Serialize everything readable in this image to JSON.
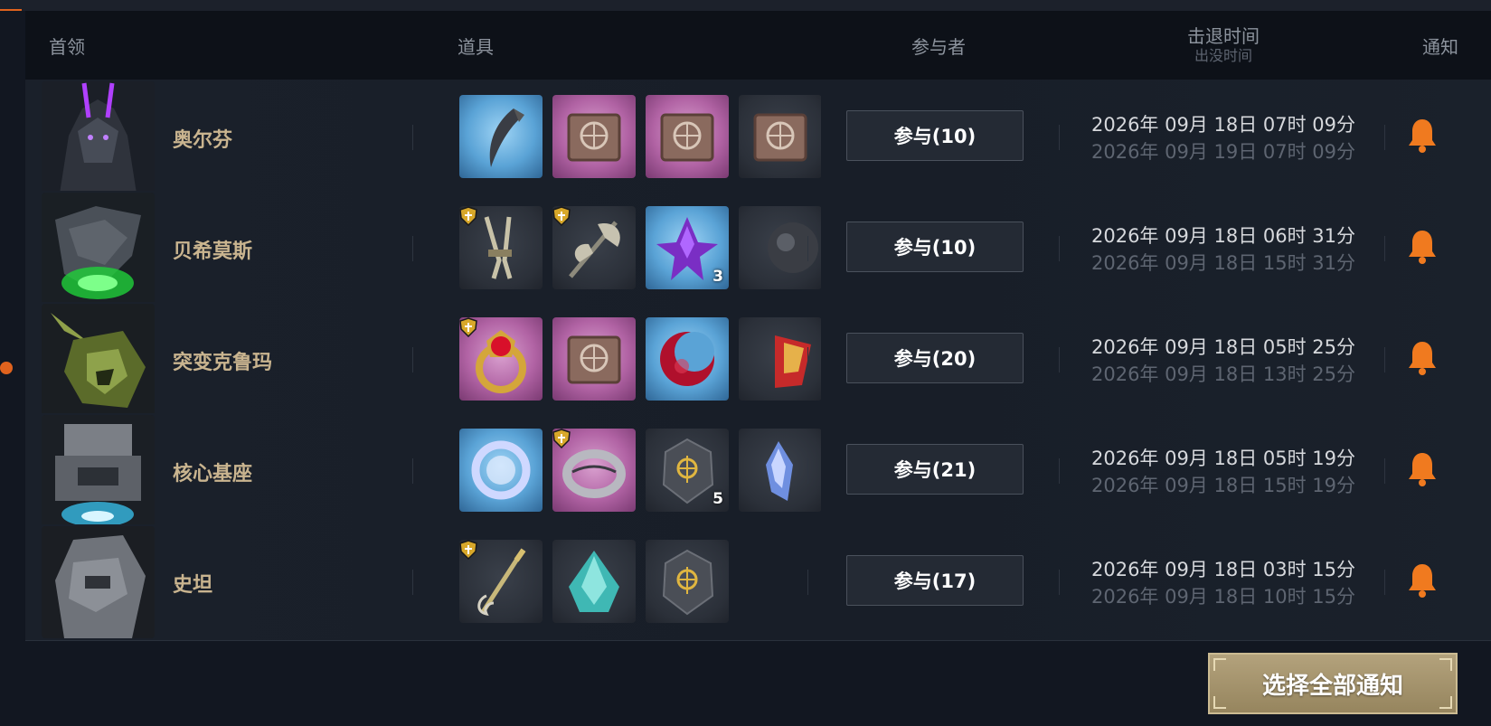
{
  "header": {
    "boss": "首领",
    "items": "道具",
    "participants": "参与者",
    "kill_time": "击退时间",
    "spawn_time": "出没时间",
    "notify": "通知"
  },
  "rows": [
    {
      "name": "奥尔芬",
      "participants": "参与(10)",
      "kill_time": "2026年 09月 18日 07时 09分",
      "spawn_time": "2026年 09月 19日 07时 09分",
      "items": [
        {
          "icon": "claw-icon",
          "bg": "blue"
        },
        {
          "icon": "spellbook-icon",
          "bg": "purple"
        },
        {
          "icon": "spellbook-icon",
          "bg": "purple"
        },
        {
          "icon": "spellbook-icon",
          "bg": "dark"
        }
      ]
    },
    {
      "name": "贝希莫斯",
      "participants": "参与(10)",
      "kill_time": "2026年 09月 18日 06时 31分",
      "spawn_time": "2026年 09月 18日 15时 31分",
      "items": [
        {
          "icon": "dual-daggers-icon",
          "bg": "dark"
        },
        {
          "icon": "battle-axe-icon",
          "bg": "dark"
        },
        {
          "icon": "purple-crystal-icon",
          "bg": "blue",
          "count": "3"
        },
        {
          "icon": "dark-orb-icon",
          "bg": "dark"
        }
      ]
    },
    {
      "name": "突变克鲁玛",
      "participants": "参与(20)",
      "kill_time": "2026年 09月 18日 05时 25分",
      "spawn_time": "2026年 09月 18日 13时 25分",
      "items": [
        {
          "icon": "ruby-ring-icon",
          "bg": "purple"
        },
        {
          "icon": "spellbook-icon",
          "bg": "purple"
        },
        {
          "icon": "red-crescent-icon",
          "bg": "blue"
        },
        {
          "icon": "gem-icon",
          "bg": "dark"
        }
      ]
    },
    {
      "name": "核心基座",
      "participants": "参与(21)",
      "kill_time": "2026年 09月 18日 05时 19分",
      "spawn_time": "2026年 09月 18日 15时 19分",
      "items": [
        {
          "icon": "crystal-ring-icon",
          "bg": "blue"
        },
        {
          "icon": "silver-ring-icon",
          "bg": "purple"
        },
        {
          "icon": "rune-stone-icon",
          "bg": "dark",
          "count": "5"
        },
        {
          "icon": "blue-shard-icon",
          "bg": "dark"
        }
      ]
    },
    {
      "name": "史坦",
      "participants": "参与(17)",
      "kill_time": "2026年 09月 18日 03时 15分",
      "spawn_time": "2026年 09月 18日 10时 15分",
      "items": [
        {
          "icon": "thorn-sword-icon",
          "bg": "dark"
        },
        {
          "icon": "teal-crystal-icon",
          "bg": "dark"
        },
        {
          "icon": "rune-stone-icon",
          "bg": "dark"
        }
      ]
    }
  ],
  "select_all_label": "选择全部通知",
  "colors": {
    "accent": "#e0631e",
    "bell": "#f07a1f",
    "boss_name": "#c9b48f",
    "button_gold": "#a8966e"
  }
}
